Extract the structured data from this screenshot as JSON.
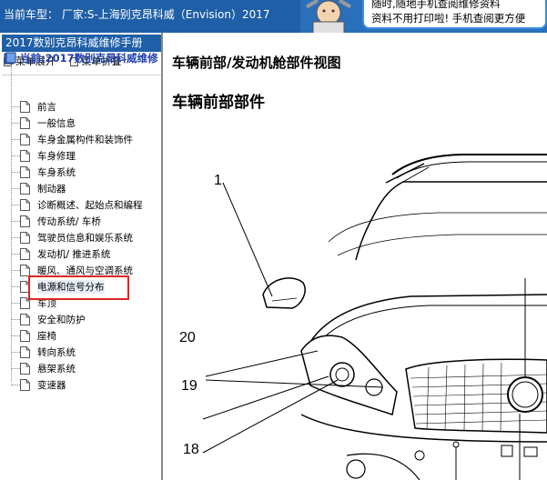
{
  "header": {
    "car_model_text": "当前车型： 厂家:S-上海别克昂科威（Envision）2017",
    "ad_line1": "随时,随地手机查阅维修资料",
    "ad_line2": "资料不用打印啦! 手机查阅更方便"
  },
  "sidebar": {
    "manual_title": "2017数别克昂科威维修手册",
    "expand_menu": "菜单展开",
    "collapse_menu": "菜单折叠",
    "root_label": "当前:2017数别克昂科威维修",
    "items": [
      {
        "label": "前言"
      },
      {
        "label": "一般信息"
      },
      {
        "label": "车身金属构件和装饰件"
      },
      {
        "label": "车身修理"
      },
      {
        "label": "车身系统"
      },
      {
        "label": "制动器"
      },
      {
        "label": "诊断概述、起始点和编程"
      },
      {
        "label": "传动系统/ 车桥"
      },
      {
        "label": "驾驶员信息和娱乐系统"
      },
      {
        "label": "发动机/ 推进系统"
      },
      {
        "label": "暖风、通风与空调系统"
      },
      {
        "label": "电源和信号分布"
      },
      {
        "label": "车顶"
      },
      {
        "label": "安全和防护"
      },
      {
        "label": "座椅"
      },
      {
        "label": "转向系统"
      },
      {
        "label": "悬架系统"
      },
      {
        "label": "变速器"
      }
    ],
    "highlighted_index": 11
  },
  "main": {
    "view_title": "车辆前部/发动机舱部件视图",
    "section_title": "车辆前部部件",
    "callouts": {
      "c1": "1",
      "c20": "20",
      "c19": "19",
      "c18": "18"
    }
  },
  "colors": {
    "header_blue": "#1f5fa8",
    "highlight_red": "#e02424",
    "root_label_blue": "#1f3fae"
  }
}
